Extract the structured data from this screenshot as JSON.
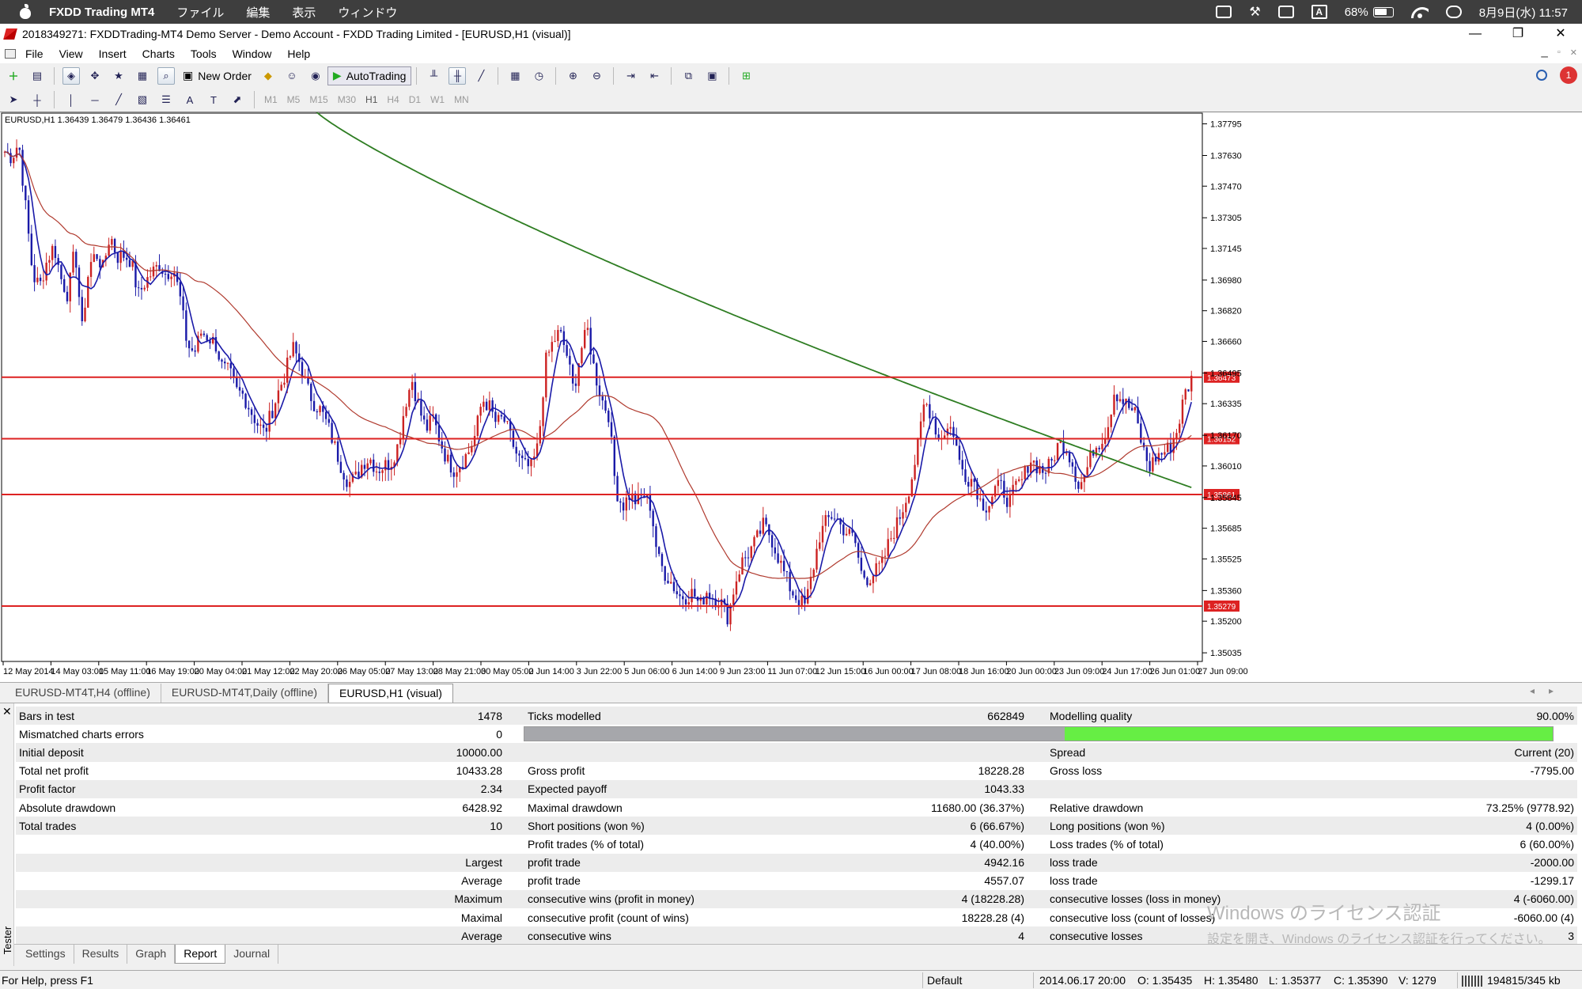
{
  "mac_menubar": {
    "app_name": "FXDD Trading MT4",
    "menus": [
      "ファイル",
      "編集",
      "表示",
      "ウィンドウ"
    ],
    "battery": "68%",
    "input_mode": "A",
    "datetime": "8月9日(水)  11:57"
  },
  "window": {
    "title": "2018349271: FXDDTrading-MT4 Demo Server - Demo Account - FXDD Trading Limited - [EURUSD,H1 (visual)]",
    "controls": [
      "—",
      "❐",
      "✕"
    ]
  },
  "menu": [
    "File",
    "View",
    "Insert",
    "Charts",
    "Tools",
    "Window",
    "Help"
  ],
  "toolbar": {
    "new_order": "New Order",
    "autotrading": "AutoTrading",
    "timeframes": [
      "M1",
      "M5",
      "M15",
      "M30",
      "H1",
      "H4",
      "D1",
      "W1",
      "MN"
    ],
    "active_timeframe": "H1",
    "alerts_count": "1"
  },
  "chart": {
    "header": "EURUSD,H1  1.36439 1.36479 1.36436 1.36461",
    "colors": {
      "bull": "#cc2222",
      "bear": "#1a1aa8",
      "ma_fast": "#1a1aa8",
      "ma_mid": "#b03a2e",
      "ma_slow": "#2e7d22",
      "level": "#dd2222"
    }
  },
  "chart_data": {
    "type": "candlestick",
    "symbol": "EURUSD",
    "timeframe": "H1",
    "ylim": [
      1.3495,
      1.3785
    ],
    "y_ticks": [
      1.37795,
      1.3763,
      1.3747,
      1.37305,
      1.37145,
      1.3698,
      1.3682,
      1.3666,
      1.36495,
      1.36335,
      1.3617,
      1.3601,
      1.35845,
      1.35685,
      1.35525,
      1.3536,
      1.352,
      1.35035
    ],
    "x_tick_labels": [
      "12 May 2014",
      "14 May 03:00",
      "15 May 11:00",
      "16 May 19:00",
      "20 May 04:00",
      "21 May 12:00",
      "22 May 20:00",
      "26 May 05:00",
      "27 May 13:00",
      "28 May 21:00",
      "30 May 05:00",
      "2 Jun 14:00",
      "3 Jun 22:00",
      "5 Jun 06:00",
      "6 Jun 14:00",
      "9 Jun 23:00",
      "11 Jun 07:00",
      "12 Jun 15:00",
      "16 Jun 00:00",
      "17 Jun 08:00",
      "18 Jun 16:00",
      "20 Jun 00:00",
      "23 Jun 09:00",
      "24 Jun 17:00",
      "26 Jun 01:00",
      "27 Jun 09:00"
    ],
    "price_levels": [
      {
        "label": "1.36473",
        "value": 1.36473
      },
      {
        "label": "1.36152",
        "value": 1.36152
      },
      {
        "label": "1.35861",
        "value": 1.35861
      },
      {
        "label": "1.35279",
        "value": 1.35279
      }
    ],
    "close_path": [
      1.3765,
      1.3762,
      1.377,
      1.3735,
      1.37,
      1.3695,
      1.3708,
      1.3716,
      1.3699,
      1.369,
      1.3715,
      1.3672,
      1.3705,
      1.3712,
      1.3704,
      1.3722,
      1.371,
      1.3711,
      1.3708,
      1.369,
      1.3697,
      1.3702,
      1.3706,
      1.3701,
      1.3705,
      1.3688,
      1.3664,
      1.366,
      1.3671,
      1.3668,
      1.3665,
      1.3652,
      1.365,
      1.364,
      1.3638,
      1.363,
      1.3623,
      1.3618,
      1.3629,
      1.364,
      1.365,
      1.3663,
      1.3655,
      1.3642,
      1.3634,
      1.363,
      1.3622,
      1.3611,
      1.36,
      1.3592,
      1.3595,
      1.3603,
      1.3605,
      1.3599,
      1.3601,
      1.3603,
      1.3612,
      1.3633,
      1.3646,
      1.3631,
      1.362,
      1.3626,
      1.3614,
      1.3604,
      1.3599,
      1.3603,
      1.3608,
      1.3617,
      1.3636,
      1.3632,
      1.3623,
      1.3626,
      1.3616,
      1.3606,
      1.3601,
      1.36,
      1.3612,
      1.3655,
      1.3665,
      1.3671,
      1.366,
      1.364,
      1.3661,
      1.3672,
      1.365,
      1.3636,
      1.3628,
      1.3589,
      1.358,
      1.3586,
      1.3582,
      1.3586,
      1.358,
      1.3553,
      1.3545,
      1.354,
      1.3533,
      1.3533,
      1.3535,
      1.3528,
      1.3536,
      1.3532,
      1.353,
      1.3522,
      1.354,
      1.3551,
      1.3556,
      1.3562,
      1.357,
      1.3565,
      1.3555,
      1.3545,
      1.3536,
      1.3531,
      1.3528,
      1.3545,
      1.3564,
      1.3572,
      1.3576,
      1.357,
      1.3566,
      1.3563,
      1.3545,
      1.3542,
      1.3546,
      1.355,
      1.3562,
      1.357,
      1.358,
      1.3592,
      1.361,
      1.3635,
      1.3628,
      1.3615,
      1.362,
      1.3621,
      1.3602,
      1.3595,
      1.3594,
      1.3582,
      1.358,
      1.3589,
      1.359,
      1.3582,
      1.359,
      1.3594,
      1.3605,
      1.3601,
      1.3598,
      1.3602,
      1.3612,
      1.3612,
      1.3603,
      1.359,
      1.3598,
      1.361,
      1.3614,
      1.362,
      1.364,
      1.3636,
      1.3632,
      1.3628,
      1.3611,
      1.36,
      1.3606,
      1.3608,
      1.3611,
      1.362,
      1.3638,
      1.3646
    ]
  },
  "chart_tabs": [
    "EURUSD-MT4T,H4 (offline)",
    "EURUSD-MT4T,Daily (offline)",
    "EURUSD,H1 (visual)"
  ],
  "report": {
    "bars_in_test": {
      "label": "Bars in test",
      "value": "1478"
    },
    "ticks_modelled": {
      "label": "Ticks modelled",
      "value": "662849"
    },
    "modelling_quality": {
      "label": "Modelling quality",
      "value": "90.00%",
      "fraction": 0.9
    },
    "mismatched": {
      "label": "Mismatched charts errors",
      "value": "0"
    },
    "initial_deposit": {
      "label": "Initial deposit",
      "value": "10000.00"
    },
    "spread": {
      "label": "Spread",
      "value": "Current (20)"
    },
    "total_net_profit": {
      "label": "Total net profit",
      "value": "10433.28"
    },
    "gross_profit": {
      "label": "Gross profit",
      "value": "18228.28"
    },
    "gross_loss": {
      "label": "Gross loss",
      "value": "-7795.00"
    },
    "profit_factor": {
      "label": "Profit factor",
      "value": "2.34"
    },
    "expected_payoff": {
      "label": "Expected payoff",
      "value": "1043.33"
    },
    "absolute_drawdown": {
      "label": "Absolute drawdown",
      "value": "6428.92"
    },
    "maximal_drawdown": {
      "label": "Maximal drawdown",
      "value": "11680.00 (36.37%)"
    },
    "relative_drawdown": {
      "label": "Relative drawdown",
      "value": "73.25% (9778.92)"
    },
    "total_trades": {
      "label": "Total trades",
      "value": "10"
    },
    "short_positions": {
      "label": "Short positions (won %)",
      "value": "6 (66.67%)"
    },
    "long_positions": {
      "label": "Long positions (won %)",
      "value": "4 (0.00%)"
    },
    "profit_trades": {
      "label": "Profit trades (% of total)",
      "value": "4 (40.00%)"
    },
    "loss_trades": {
      "label": "Loss trades (% of total)",
      "value": "6 (60.00%)"
    },
    "largest": {
      "label": "Largest",
      "p_label": "profit trade",
      "p_value": "4942.16",
      "l_label": "loss trade",
      "l_value": "-2000.00"
    },
    "average": {
      "label": "Average",
      "p_label": "profit trade",
      "p_value": "4557.07",
      "l_label": "loss trade",
      "l_value": "-1299.17"
    },
    "maximum": {
      "label": "Maximum",
      "p_label": "consecutive wins (profit in money)",
      "p_value": "4 (18228.28)",
      "l_label": "consecutive losses (loss in money)",
      "l_value": "4 (-6060.00)"
    },
    "maximal": {
      "label": "Maximal",
      "p_label": "consecutive profit (count of wins)",
      "p_value": "18228.28 (4)",
      "l_label": "consecutive loss (count of losses)",
      "l_value": "-6060.00 (4)"
    },
    "average2": {
      "label": "Average",
      "p_label": "consecutive wins",
      "p_value": "4",
      "l_label": "consecutive losses",
      "l_value": "3"
    }
  },
  "tester_tabs": [
    "Settings",
    "Results",
    "Graph",
    "Report",
    "Journal"
  ],
  "tester_label": "Tester",
  "watermark": {
    "line1": "Windows のライセンス認証",
    "line2": "設定を開き、Windows のライセンス認証を行ってください。"
  },
  "status": {
    "help": "For Help, press F1",
    "profile": "Default",
    "datetime": "2014.06.17 20:00",
    "open": "O: 1.35435",
    "high": "H: 1.35480",
    "low": "L: 1.35377",
    "close": "C: 1.35390",
    "volume": "V: 1279",
    "traffic": "194815/345 kb"
  }
}
